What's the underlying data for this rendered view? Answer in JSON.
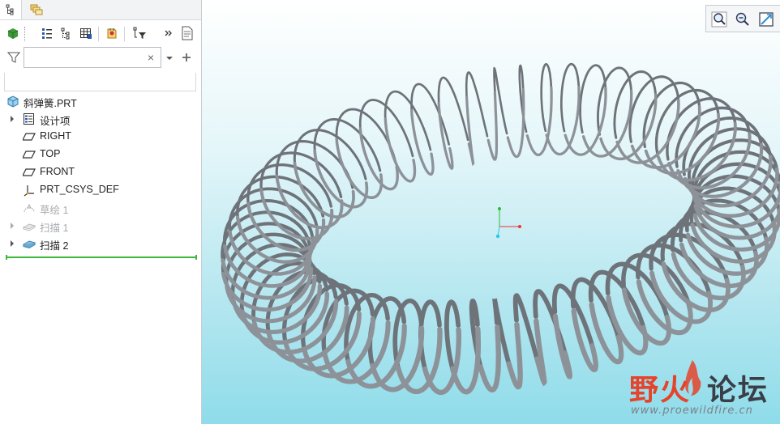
{
  "tabs": {
    "model_tree_icon": "model-tree-icon",
    "layer_tree_icon": "layer-tree-icon"
  },
  "toolbar": {
    "items": [
      "display-icon",
      "columns-icon",
      "tree-filter-icon",
      "table-icon",
      "settings-icon",
      "show-filter-icon",
      "more-icon",
      "doc-icon"
    ]
  },
  "filter": {
    "value": "",
    "clear_symbol": "×"
  },
  "tree": {
    "items": [
      {
        "label": "斜弹簧.PRT",
        "icon": "part-icon",
        "state": "normal",
        "expandable": false
      },
      {
        "label": "设计项",
        "icon": "design-items-icon",
        "state": "normal",
        "expandable": true
      },
      {
        "label": "RIGHT",
        "icon": "datum-plane-icon",
        "state": "normal",
        "expandable": false
      },
      {
        "label": "TOP",
        "icon": "datum-plane-icon",
        "state": "normal",
        "expandable": false
      },
      {
        "label": "FRONT",
        "icon": "datum-plane-icon",
        "state": "normal",
        "expandable": false
      },
      {
        "label": "PRT_CSYS_DEF",
        "icon": "csys-icon",
        "state": "normal",
        "expandable": false
      },
      {
        "label": "草绘 1",
        "icon": "sketch-icon",
        "state": "suppressed",
        "expandable": false
      },
      {
        "label": "扫描 1",
        "icon": "sweep-icon",
        "state": "suppressed",
        "expandable": true
      },
      {
        "label": "扫描 2",
        "icon": "sweep-icon",
        "state": "normal",
        "expandable": true
      }
    ]
  },
  "view_toolbar": {
    "items": [
      "zoom-in-icon",
      "zoom-out-icon",
      "refit-icon"
    ]
  },
  "watermark": {
    "title": "野火论坛",
    "url": "www.proewildfire.cn"
  },
  "colors": {
    "spring": "#8d9299",
    "background_bottom": "#8fdcea",
    "insert_line": "#3cb83c",
    "watermark_red": "#e5432b"
  }
}
